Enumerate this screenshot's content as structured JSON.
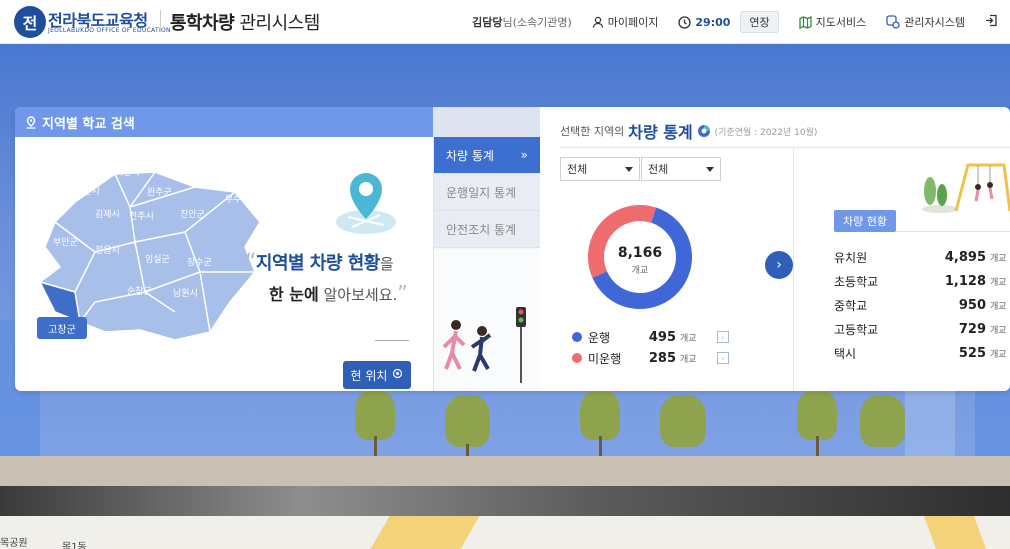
{
  "header": {
    "logo_letter": "전",
    "org_name": "전라북도교육청",
    "org_name_en": "JEOLLABUKDO OFFICE OF EDUCATION",
    "system_bold": "통학차량",
    "system_rest": " 관리시스템",
    "user_name": "김담당",
    "user_suffix": "님(소속기관명)",
    "mypage_label": "마이페이지",
    "timer": "29:00",
    "extend_label": "연장",
    "map_service_label": "지도서비스",
    "admin_label": "관리자시스템",
    "icons": [
      "user-icon",
      "clock-icon",
      "map-icon",
      "admin-icon",
      "logout-icon"
    ]
  },
  "search": {
    "title": "지역별 학교 검색",
    "regions": [
      "익산시",
      "군산시",
      "완주군",
      "김제시",
      "전주시",
      "진안군",
      "무주군",
      "부안군",
      "정읍시",
      "임실군",
      "장수군",
      "고창군",
      "순창군",
      "남원시"
    ],
    "selected_region": "고창군",
    "tagline_quote_open": "“",
    "tagline_line1_bold": "지역별 차량 현황",
    "tagline_line1_rest": "을",
    "tagline_line2_bold": "한 눈에",
    "tagline_line2_rest": " 알아보세요.",
    "tagline_quote_close": "”",
    "locate_label": "현 위치"
  },
  "tabs": [
    {
      "label": "차량 통계",
      "active": true
    },
    {
      "label": "운행일지 통계",
      "active": false
    },
    {
      "label": "안전조치 통계",
      "active": false
    }
  ],
  "stats": {
    "title_prefix": "선택한 지역의",
    "title_main": "차량 통계",
    "date_note": "(기준연월 : 2022년 10월)",
    "select1": "전체",
    "select2": "전체",
    "total": "8,166",
    "unit": "개교",
    "legend": [
      {
        "label": "운행",
        "value": "495",
        "color": "#3f67d8"
      },
      {
        "label": "미운행",
        "value": "285",
        "color": "#ee6b6e"
      }
    ],
    "count_title": "차량 현황",
    "counts": [
      {
        "label": "유치원",
        "value": "4,895"
      },
      {
        "label": "초등학교",
        "value": "1,128"
      },
      {
        "label": "중학교",
        "value": "950"
      },
      {
        "label": "고등학교",
        "value": "729"
      },
      {
        "label": "택시",
        "value": "525"
      }
    ]
  },
  "map": {
    "labels": [
      "목1동",
      "목공원"
    ]
  },
  "chart_data": {
    "type": "pie",
    "categories": [
      "운행",
      "미운행"
    ],
    "values": [
      495,
      285
    ],
    "center_label": "8,166"
  }
}
